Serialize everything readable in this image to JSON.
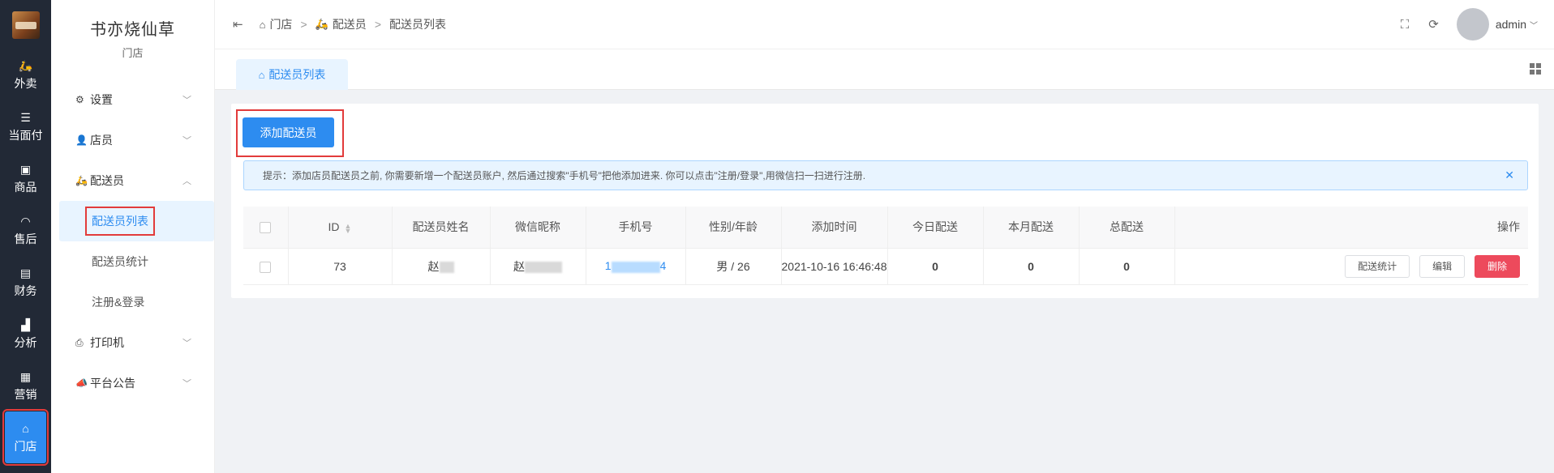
{
  "rail": {
    "items": [
      {
        "label": "外卖",
        "icon": "motorcycle-icon"
      },
      {
        "label": "当面付",
        "icon": "list-icon"
      },
      {
        "label": "商品",
        "icon": "gift-icon"
      },
      {
        "label": "售后",
        "icon": "headset-icon"
      },
      {
        "label": "财务",
        "icon": "ledger-icon"
      },
      {
        "label": "分析",
        "icon": "bar-chart-icon"
      },
      {
        "label": "营销",
        "icon": "gift-box-icon"
      },
      {
        "label": "门店",
        "icon": "store-icon"
      }
    ]
  },
  "subnav": {
    "shop_name": "书亦烧仙草",
    "shop_sub": "门店",
    "menu": {
      "settings": "设置",
      "staff": "店员",
      "courier": "配送员",
      "courier_list": "配送员列表",
      "courier_stats": "配送员统计",
      "register": "注册&登录",
      "printer": "打印机",
      "notice": "平台公告"
    }
  },
  "topbar": {
    "crumb1": "门店",
    "crumb2": "配送员",
    "crumb3": "配送员列表",
    "sep": ">",
    "user": "admin"
  },
  "tabs": {
    "active": "配送员列表"
  },
  "toolbar": {
    "add_label": "添加配送员"
  },
  "tip": {
    "text": "提示：添加店员配送员之前, 你需要新增一个配送员账户, 然后通过搜索\"手机号\"把他添加进来. 你可以点击\"注册/登录\",用微信扫一扫进行注册."
  },
  "table": {
    "headers": {
      "id": "ID",
      "name": "配送员姓名",
      "wechat": "微信昵称",
      "phone": "手机号",
      "gender_age": "性别/年龄",
      "added": "添加时间",
      "today": "今日配送",
      "month": "本月配送",
      "total": "总配送",
      "ops": "操作"
    },
    "rows": [
      {
        "id": "73",
        "name_prefix": "赵",
        "wechat_prefix": "赵",
        "phone_prefix": "1",
        "phone_suffix": "4",
        "gender_age": "男 / 26",
        "added": "2021-10-16 16:46:48",
        "today": "0",
        "month": "0",
        "total": "0"
      }
    ],
    "actions": {
      "stats": "配送统计",
      "edit": "编辑",
      "delete": "删除"
    }
  }
}
